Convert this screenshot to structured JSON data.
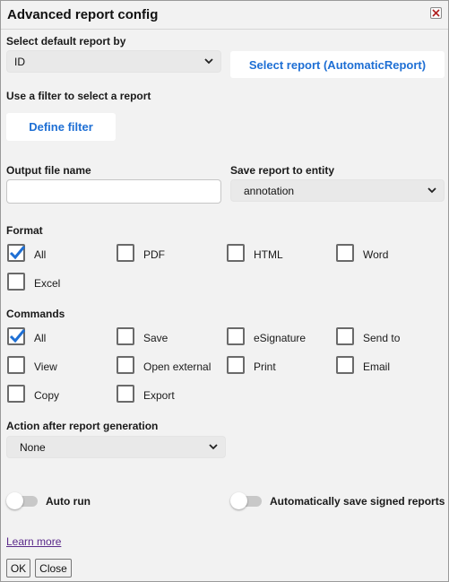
{
  "window": {
    "title": "Advanced report config"
  },
  "default_report": {
    "label": "Select default report by",
    "select_value": "ID",
    "select_button": "Select report (AutomaticReport)"
  },
  "filter": {
    "label": "Use a filter to select a report",
    "button": "Define filter"
  },
  "output": {
    "file_label": "Output file name",
    "file_value": "",
    "entity_label": "Save report to entity",
    "entity_value": "annotation"
  },
  "format": {
    "label": "Format",
    "options": [
      {
        "label": "All",
        "checked": true
      },
      {
        "label": "PDF",
        "checked": false
      },
      {
        "label": "HTML",
        "checked": false
      },
      {
        "label": "Word",
        "checked": false
      },
      {
        "label": "Excel",
        "checked": false
      }
    ]
  },
  "commands": {
    "label": "Commands",
    "options": [
      {
        "label": "All",
        "checked": true
      },
      {
        "label": "Save",
        "checked": false
      },
      {
        "label": "eSignature",
        "checked": false
      },
      {
        "label": "Send to",
        "checked": false
      },
      {
        "label": "View",
        "checked": false
      },
      {
        "label": "Open external",
        "checked": false
      },
      {
        "label": "Print",
        "checked": false
      },
      {
        "label": "Email",
        "checked": false
      },
      {
        "label": "Copy",
        "checked": false
      },
      {
        "label": "Export",
        "checked": false
      }
    ]
  },
  "action": {
    "label": "Action after report generation",
    "value": "None"
  },
  "toggles": {
    "auto_run": {
      "label": "Auto run",
      "on": false
    },
    "auto_save": {
      "label": "Automatically save signed reports",
      "on": false
    }
  },
  "footer": {
    "learn_more": "Learn more",
    "ok": "OK",
    "close": "Close"
  },
  "colors": {
    "accent": "#1e6fd4",
    "check": "#1e6fd4",
    "link_visited": "#5a2a8a"
  }
}
